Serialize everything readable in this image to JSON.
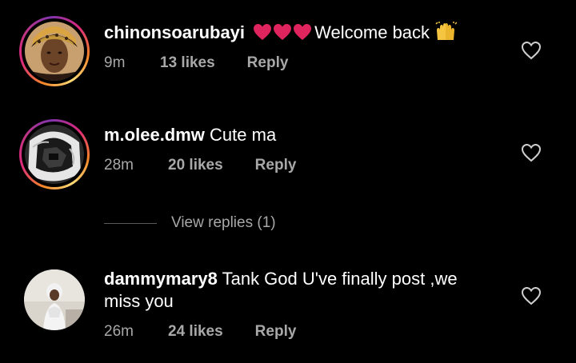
{
  "comments": [
    {
      "username": "chinonsoarubayi",
      "text": "Welcome back",
      "time": "9m",
      "likes": "13 likes",
      "reply": "Reply",
      "emojis_before": [
        "red-heart",
        "red-heart",
        "red-heart"
      ],
      "emoji_after": "raising-hands"
    },
    {
      "username": "m.olee.dmw",
      "text": "Cute ma",
      "time": "28m",
      "likes": "20 likes",
      "reply": "Reply"
    },
    {
      "username": "dammymary8",
      "text": "Tank God U've finally post ,we miss you",
      "time": "26m",
      "likes": "24 likes",
      "reply": "Reply"
    }
  ],
  "view_replies": "View replies (1)",
  "colors": {
    "background": "#000000",
    "text": "#ffffff",
    "meta": "#a8a8a8",
    "heart": "#e0245e"
  }
}
